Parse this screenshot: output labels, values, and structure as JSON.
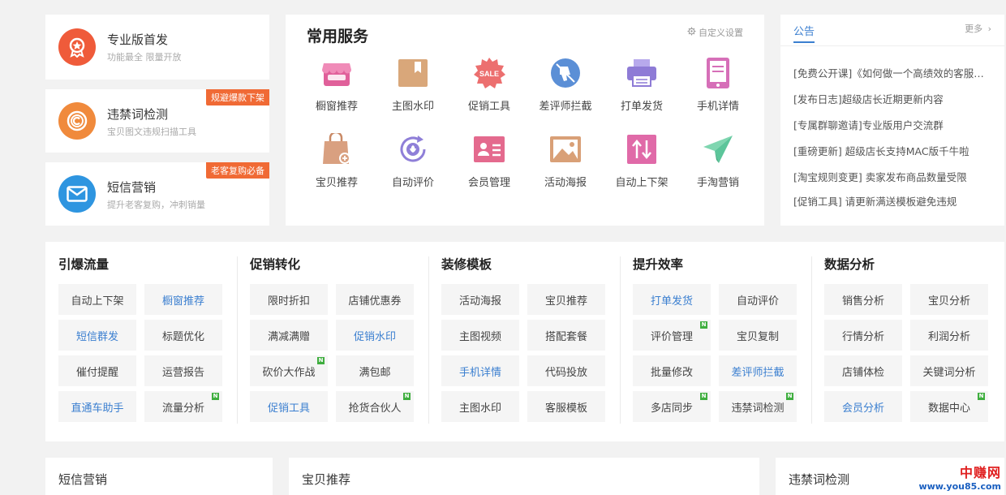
{
  "features": [
    {
      "title": "专业版首发",
      "sub": "功能最全  限量开放",
      "ribbon": "",
      "color": "#ef5b3a",
      "icon": "badge-star-icon"
    },
    {
      "title": "违禁词检测",
      "sub": "宝贝图文违规扫描工具",
      "ribbon": "规避爆款下架",
      "color": "#f08a3c",
      "icon": "copyright-icon"
    },
    {
      "title": "短信营销",
      "sub": "提升老客复购，冲刺销量",
      "ribbon": "老客复购必备",
      "color": "#2e95e0",
      "icon": "envelope-icon"
    }
  ],
  "services": {
    "title": "常用服务",
    "custom_label": "自定义设置",
    "items": [
      {
        "label": "橱窗推荐",
        "icon": "storefront-icon",
        "color": "#e0609a"
      },
      {
        "label": "主图水印",
        "icon": "bookmark-icon",
        "color": "#d9a77a"
      },
      {
        "label": "促销工具",
        "icon": "sale-badge-icon",
        "color": "#ec6f6f"
      },
      {
        "label": "差评师拦截",
        "icon": "thumbs-down-icon",
        "color": "#5b8fd6"
      },
      {
        "label": "打单发货",
        "icon": "printer-icon",
        "color": "#8e7bd6"
      },
      {
        "label": "手机详情",
        "icon": "tablet-icon",
        "color": "#d66fb8"
      },
      {
        "label": "宝贝推荐",
        "icon": "shopping-bag-icon",
        "color": "#d9a080"
      },
      {
        "label": "自动评价",
        "icon": "refresh-flower-icon",
        "color": "#8f7fd8"
      },
      {
        "label": "会员管理",
        "icon": "id-card-icon",
        "color": "#e46a8e"
      },
      {
        "label": "活动海报",
        "icon": "picture-icon",
        "color": "#d9a077"
      },
      {
        "label": "自动上下架",
        "icon": "up-down-arrows-icon",
        "color": "#e06aa8"
      },
      {
        "label": "手淘营销",
        "icon": "paper-plane-icon",
        "color": "#5cc59a"
      }
    ]
  },
  "notice": {
    "tab": "公告",
    "more": "更多",
    "items": [
      "[免费公开课]《如何做一个高绩效的客服团队》",
      "[发布日志]超级店长近期更新内容",
      "[专属群聊邀请]专业版用户交流群",
      "[重磅更新] 超级店长支持MAC版千牛啦",
      "[淘宝规则变更] 卖家发布商品数量受限",
      "[促销工具] 请更新满送模板避免违规"
    ]
  },
  "categories": [
    {
      "title": "引爆流量",
      "buttons": [
        {
          "label": "自动上下架",
          "blue": false,
          "new": false
        },
        {
          "label": "橱窗推荐",
          "blue": true,
          "new": false
        },
        {
          "label": "短信群发",
          "blue": true,
          "new": false
        },
        {
          "label": "标题优化",
          "blue": false,
          "new": false
        },
        {
          "label": "催付提醒",
          "blue": false,
          "new": false
        },
        {
          "label": "运营报告",
          "blue": false,
          "new": false
        },
        {
          "label": "直通车助手",
          "blue": true,
          "new": false
        },
        {
          "label": "流量分析",
          "blue": false,
          "new": true
        }
      ]
    },
    {
      "title": "促销转化",
      "buttons": [
        {
          "label": "限时折扣",
          "blue": false,
          "new": false
        },
        {
          "label": "店铺优惠券",
          "blue": false,
          "new": false
        },
        {
          "label": "满减满赠",
          "blue": false,
          "new": false
        },
        {
          "label": "促销水印",
          "blue": true,
          "new": false
        },
        {
          "label": "砍价大作战",
          "blue": false,
          "new": true
        },
        {
          "label": "满包邮",
          "blue": false,
          "new": false
        },
        {
          "label": "促销工具",
          "blue": true,
          "new": false
        },
        {
          "label": "抢货合伙人",
          "blue": false,
          "new": true
        }
      ]
    },
    {
      "title": "装修模板",
      "buttons": [
        {
          "label": "活动海报",
          "blue": false,
          "new": false
        },
        {
          "label": "宝贝推荐",
          "blue": false,
          "new": false
        },
        {
          "label": "主图视频",
          "blue": false,
          "new": false
        },
        {
          "label": "搭配套餐",
          "blue": false,
          "new": false
        },
        {
          "label": "手机详情",
          "blue": true,
          "new": false
        },
        {
          "label": "代码投放",
          "blue": false,
          "new": false
        },
        {
          "label": "主图水印",
          "blue": false,
          "new": false
        },
        {
          "label": "客服模板",
          "blue": false,
          "new": false
        }
      ]
    },
    {
      "title": "提升效率",
      "buttons": [
        {
          "label": "打单发货",
          "blue": true,
          "new": false
        },
        {
          "label": "自动评价",
          "blue": false,
          "new": false
        },
        {
          "label": "评价管理",
          "blue": false,
          "new": true
        },
        {
          "label": "宝贝复制",
          "blue": false,
          "new": false
        },
        {
          "label": "批量修改",
          "blue": false,
          "new": false
        },
        {
          "label": "差评师拦截",
          "blue": true,
          "new": false
        },
        {
          "label": "多店同步",
          "blue": false,
          "new": true
        },
        {
          "label": "违禁词检测",
          "blue": false,
          "new": true
        }
      ]
    },
    {
      "title": "数据分析",
      "buttons": [
        {
          "label": "销售分析",
          "blue": false,
          "new": false
        },
        {
          "label": "宝贝分析",
          "blue": false,
          "new": false
        },
        {
          "label": "行情分析",
          "blue": false,
          "new": false
        },
        {
          "label": "利润分析",
          "blue": false,
          "new": false
        },
        {
          "label": "店铺体检",
          "blue": false,
          "new": false
        },
        {
          "label": "关键词分析",
          "blue": false,
          "new": false
        },
        {
          "label": "会员分析",
          "blue": true,
          "new": false
        },
        {
          "label": "数据中心",
          "blue": false,
          "new": true
        }
      ]
    }
  ],
  "bottom": {
    "sms": "短信营销",
    "recommend": "宝贝推荐",
    "forbidden": "违禁词检测"
  },
  "new_badge": "N",
  "watermark": {
    "line1": "中赚网",
    "line2": "www.you85.com"
  },
  "colors": {
    "blue": "#3b7fd0",
    "ribbon": "#f06a35",
    "new_badge": "#3fae3f"
  }
}
